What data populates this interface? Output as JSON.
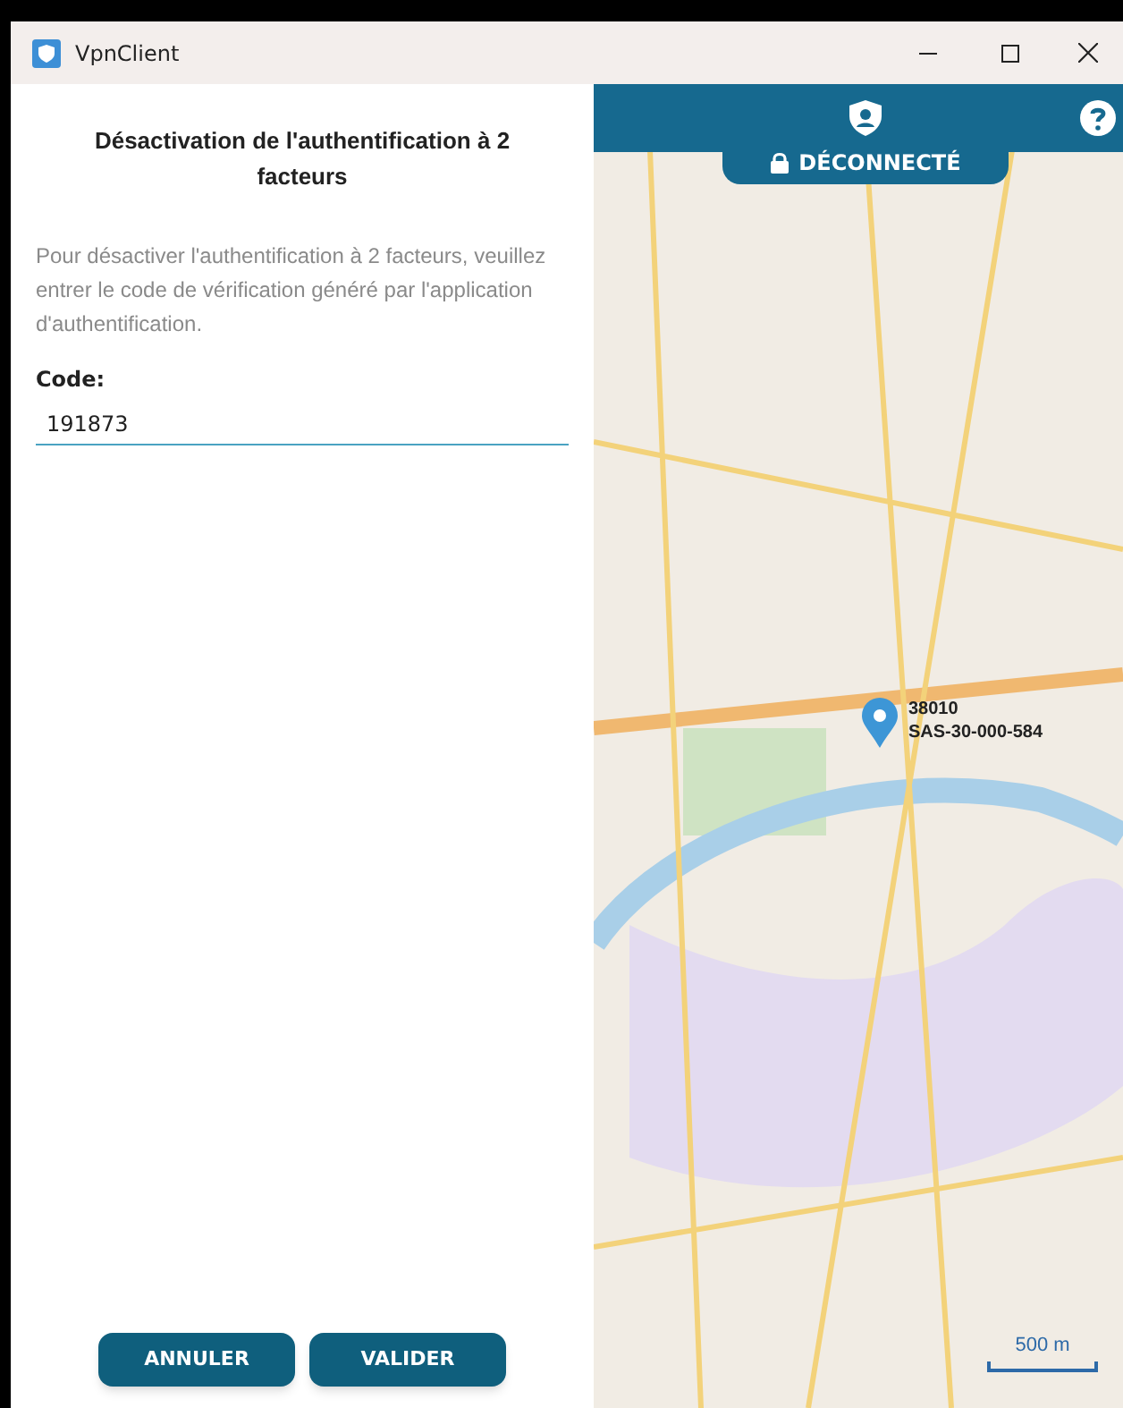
{
  "window": {
    "title": "VpnClient"
  },
  "dialog": {
    "title": "Désactivation de l'authentification à 2 facteurs",
    "description": "Pour désactiver l'authentification à 2 facteurs, veuillez entrer le code de vérification généré par l'application d'authentification.",
    "field": {
      "label": "Code:",
      "value": "191873"
    },
    "buttons": [
      "ANNULER",
      "VALIDER"
    ]
  },
  "status": {
    "label": "DÉCONNECTÉ"
  },
  "map": {
    "marker": {
      "line_1": "38010",
      "line_2": "SAS-30-000-584"
    },
    "scale": "500 m"
  }
}
